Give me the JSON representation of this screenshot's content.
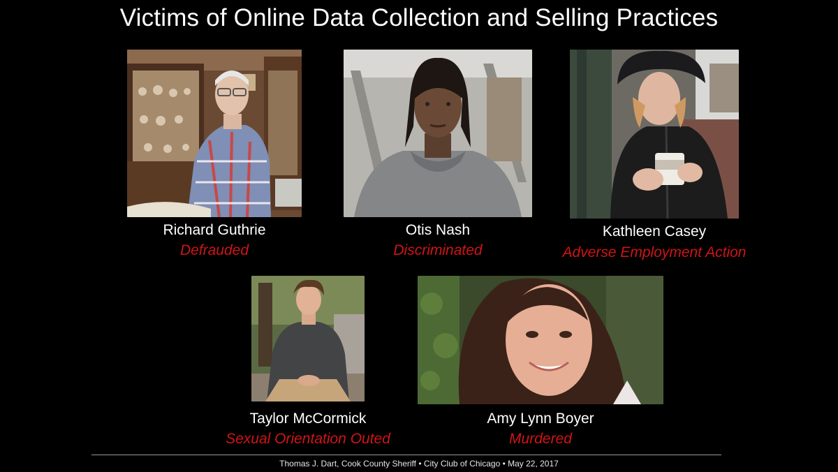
{
  "slide": {
    "title": "Victims of Online Data Collection and Selling Practices",
    "footer": "Thomas J. Dart, Cook County Sheriff • City Club of Chicago • May 22, 2017"
  },
  "victims": [
    {
      "name": "Richard Guthrie",
      "outcome": "Defrauded"
    },
    {
      "name": "Otis Nash",
      "outcome": "Discriminated"
    },
    {
      "name": "Kathleen Casey",
      "outcome": "Adverse Employment Action"
    },
    {
      "name": "Taylor McCormick",
      "outcome": "Sexual Orientation Outed"
    },
    {
      "name": "Amy Lynn Boyer",
      "outcome": "Murdered"
    }
  ],
  "colors": {
    "background": "#000000",
    "text": "#ffffff",
    "outcome": "#d01416"
  }
}
